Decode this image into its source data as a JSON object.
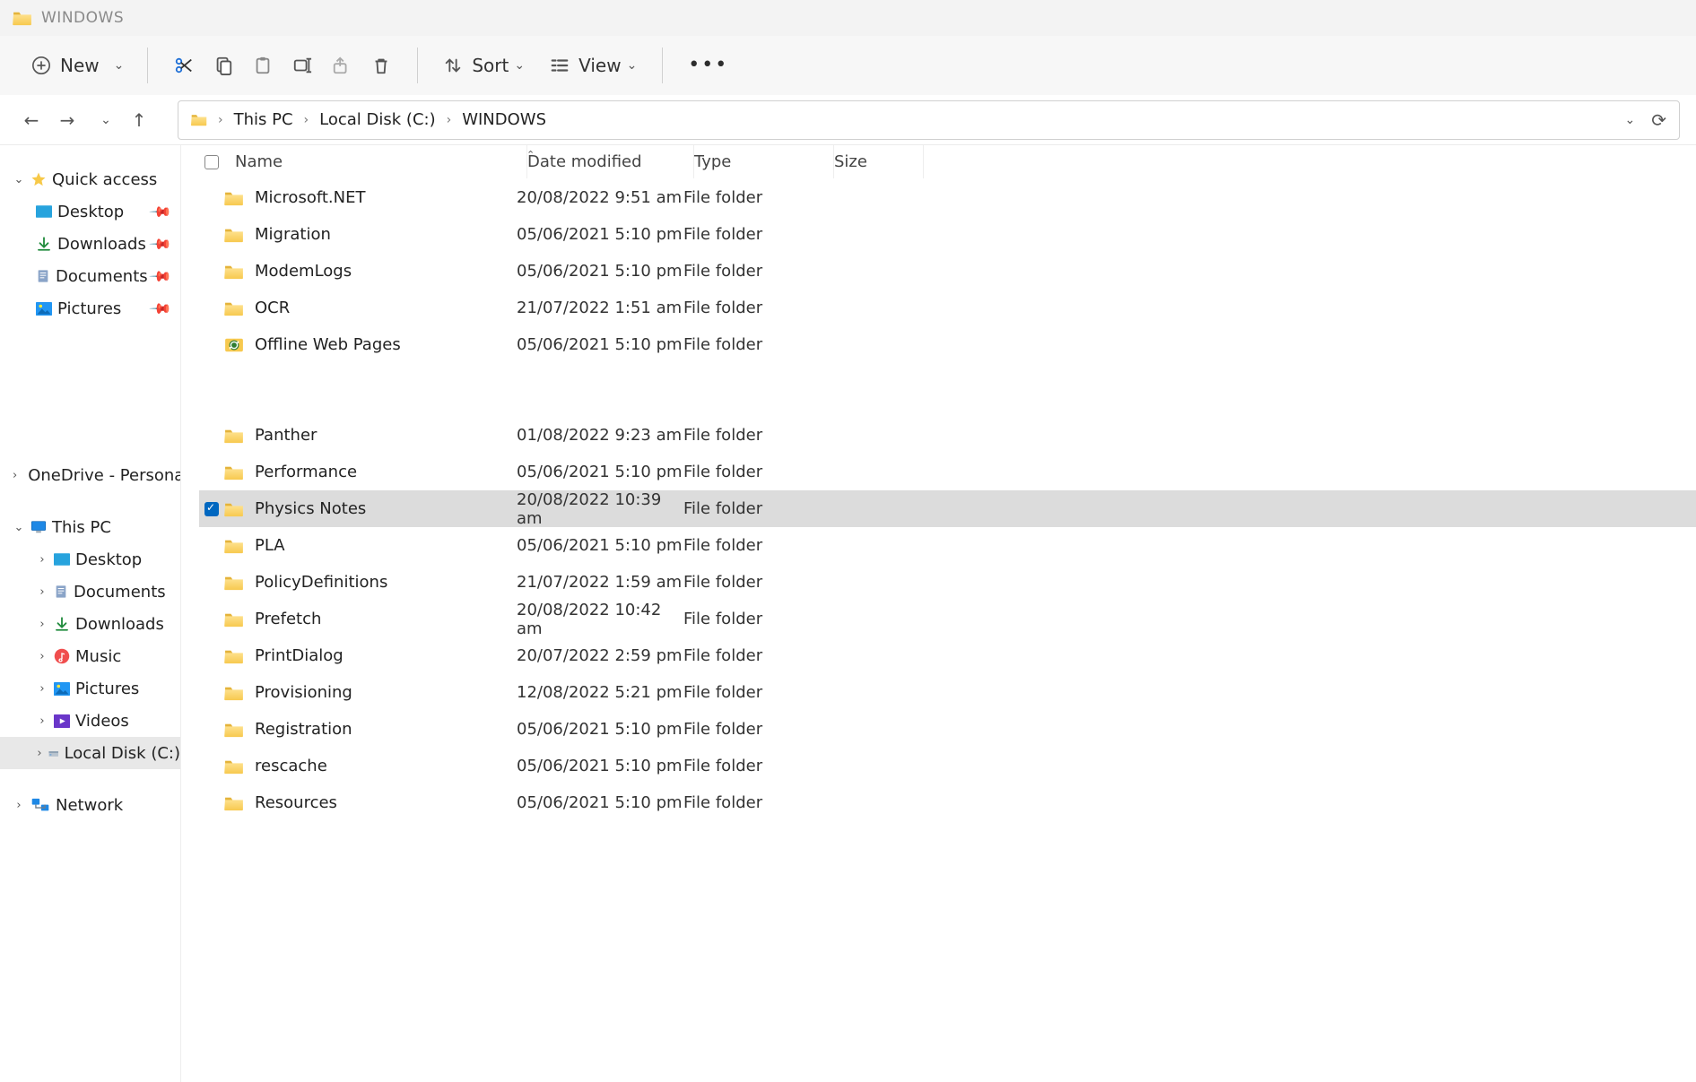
{
  "window": {
    "title": "WINDOWS"
  },
  "toolbar": {
    "new_label": "New",
    "sort_label": "Sort",
    "view_label": "View"
  },
  "breadcrumb": [
    "This PC",
    "Local Disk (C:)",
    "WINDOWS"
  ],
  "headers": {
    "name": "Name",
    "date": "Date modified",
    "type": "Type",
    "size": "Size"
  },
  "sidebar": {
    "quick_access": "Quick access",
    "quick_items": [
      {
        "label": "Desktop"
      },
      {
        "label": "Downloads"
      },
      {
        "label": "Documents"
      },
      {
        "label": "Pictures"
      }
    ],
    "onedrive": "OneDrive - Personal",
    "this_pc": "This PC",
    "this_pc_items": [
      {
        "label": "Desktop"
      },
      {
        "label": "Documents"
      },
      {
        "label": "Downloads"
      },
      {
        "label": "Music"
      },
      {
        "label": "Pictures"
      },
      {
        "label": "Videos"
      },
      {
        "label": "Local Disk (C:)"
      }
    ],
    "network": "Network"
  },
  "files": [
    {
      "name": "Microsoft.NET",
      "date": "20/08/2022 9:51 am",
      "type": "File folder",
      "icon": "folder"
    },
    {
      "name": "Migration",
      "date": "05/06/2021 5:10 pm",
      "type": "File folder",
      "icon": "folder"
    },
    {
      "name": "ModemLogs",
      "date": "05/06/2021 5:10 pm",
      "type": "File folder",
      "icon": "folder"
    },
    {
      "name": "OCR",
      "date": "21/07/2022 1:51 am",
      "type": "File folder",
      "icon": "folder"
    },
    {
      "name": "Offline Web Pages",
      "date": "05/06/2021 5:10 pm",
      "type": "File folder",
      "icon": "sync"
    },
    {
      "gap": true
    },
    {
      "name": "Panther",
      "date": "01/08/2022 9:23 am",
      "type": "File folder",
      "icon": "folder"
    },
    {
      "name": "Performance",
      "date": "05/06/2021 5:10 pm",
      "type": "File folder",
      "icon": "folder"
    },
    {
      "name": "Physics Notes",
      "date": "20/08/2022 10:39 am",
      "type": "File folder",
      "icon": "folder",
      "selected": true
    },
    {
      "name": "PLA",
      "date": "05/06/2021 5:10 pm",
      "type": "File folder",
      "icon": "folder"
    },
    {
      "name": "PolicyDefinitions",
      "date": "21/07/2022 1:59 am",
      "type": "File folder",
      "icon": "folder"
    },
    {
      "name": "Prefetch",
      "date": "20/08/2022 10:42 am",
      "type": "File folder",
      "icon": "folder"
    },
    {
      "name": "PrintDialog",
      "date": "20/07/2022 2:59 pm",
      "type": "File folder",
      "icon": "folder"
    },
    {
      "name": "Provisioning",
      "date": "12/08/2022 5:21 pm",
      "type": "File folder",
      "icon": "folder"
    },
    {
      "name": "Registration",
      "date": "05/06/2021 5:10 pm",
      "type": "File folder",
      "icon": "folder"
    },
    {
      "name": "rescache",
      "date": "05/06/2021 5:10 pm",
      "type": "File folder",
      "icon": "folder"
    },
    {
      "name": "Resources",
      "date": "05/06/2021 5:10 pm",
      "type": "File folder",
      "icon": "folder"
    }
  ]
}
